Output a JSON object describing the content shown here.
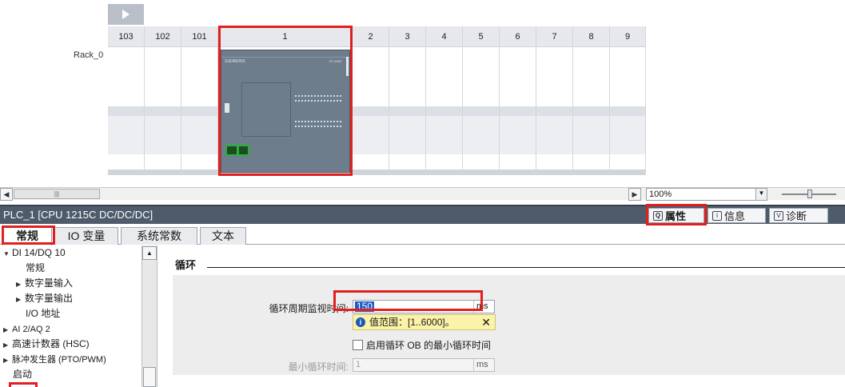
{
  "rack": {
    "name": "Rack_0",
    "slots": [
      "103",
      "102",
      "101",
      "1",
      "2",
      "3",
      "4",
      "5",
      "6",
      "7",
      "8",
      "9"
    ],
    "module_brand": "SIEMENS",
    "module_model": "S7-1200",
    "module_body_color": "#6e7d8c",
    "highlight_color": "#e21f1f"
  },
  "scrollbar": {
    "thumb_icon": "grip-icon",
    "zoom": "100%"
  },
  "inspector": {
    "title": "PLC_1 [CPU 1215C DC/DC/DC]",
    "header_color": "#4d5b6a",
    "tabs": [
      {
        "label": "属性",
        "icon": "properties-icon"
      },
      {
        "label": "信息",
        "icon": "info-icon"
      },
      {
        "label": "诊断",
        "icon": "diagnostics-icon"
      }
    ],
    "subtabs": [
      "常规",
      "IO 变量",
      "系统常数",
      "文本"
    ]
  },
  "tree": {
    "items": [
      {
        "label": "DI 14/DQ 10"
      },
      {
        "label": "常规"
      },
      {
        "label": "数字量输入"
      },
      {
        "label": "数字量输出"
      },
      {
        "label": "I/O 地址"
      },
      {
        "label": "AI 2/AQ 2"
      },
      {
        "label": "高速计数器 (HSC)"
      },
      {
        "label": "脉冲发生器 (PTO/PWM)"
      },
      {
        "label": "启动"
      }
    ]
  },
  "cycle": {
    "section_title": "循环",
    "monitor_label": "循环周期监视时间:",
    "monitor_value": "150",
    "unit": "ms",
    "range_hint": "值范围：[1..6000]。",
    "enable_min_label": "启用循环 OB 的最小循环时间",
    "min_label": "最小循环时间:",
    "min_value": "1",
    "accent_color": "#1f5cc5"
  }
}
